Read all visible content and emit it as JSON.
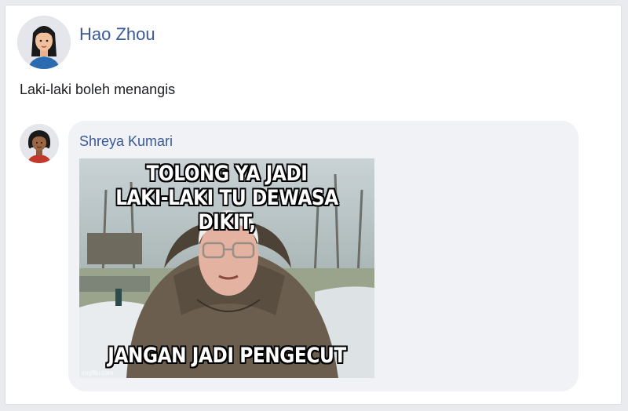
{
  "post": {
    "author": "Hao Zhou",
    "text": "Laki-laki boleh menangis",
    "avatar_icon": "female-avatar-icon"
  },
  "comment": {
    "author": "Shreya Kumari",
    "avatar_icon": "female-avatar-icon",
    "meme": {
      "top_line_1": "TOLONG YA JADI",
      "top_line_2": "LAKI-LAKI TU DEWASA DIKIT,",
      "bottom_line": "JANGAN JADI PENGECUT",
      "watermark": "imgflip.com"
    }
  },
  "colors": {
    "link": "#3b5998",
    "bubble": "#f0f2f5",
    "page_bg": "#e9ebee"
  }
}
